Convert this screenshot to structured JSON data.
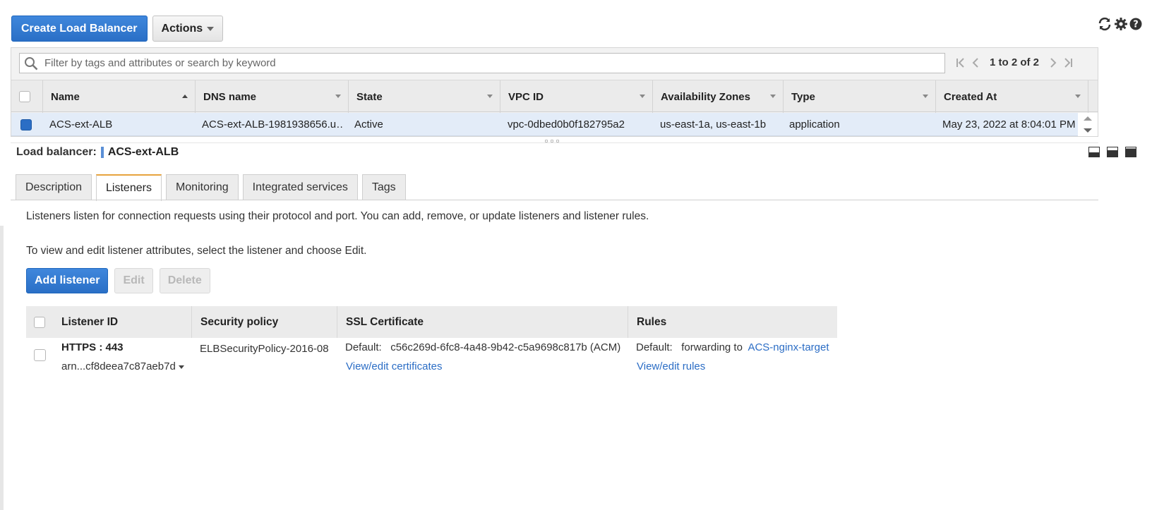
{
  "toolbar": {
    "create_label": "Create Load Balancer",
    "actions_label": "Actions"
  },
  "top_icons": [
    "refresh-icon",
    "gear-icon",
    "help-icon"
  ],
  "grid": {
    "search_placeholder": "Filter by tags and attributes or search by keyword",
    "pagination": "1 to 2 of 2",
    "columns": [
      {
        "label": "Name",
        "sort": "asc"
      },
      {
        "label": "DNS name",
        "sort": "none"
      },
      {
        "label": "State",
        "sort": "none"
      },
      {
        "label": "VPC ID",
        "sort": "none"
      },
      {
        "label": "Availability Zones",
        "sort": "none"
      },
      {
        "label": "Type",
        "sort": "none"
      },
      {
        "label": "Created At",
        "sort": "none"
      }
    ],
    "rows": [
      {
        "selected": true,
        "name": "ACS-ext-ALB",
        "dns": "ACS-ext-ALB-1981938656.u…",
        "state": "Active",
        "vpc": "vpc-0dbed0b0f182795a2",
        "azs": "us-east-1a, us-east-1b",
        "type": "application",
        "created": "May 23, 2022 at 8:04:01 PM …"
      }
    ]
  },
  "detail": {
    "label": "Load balancer:",
    "name": "ACS-ext-ALB",
    "tabs": [
      "Description",
      "Listeners",
      "Monitoring",
      "Integrated services",
      "Tags"
    ],
    "active_tab": "Listeners",
    "intro": "Listeners listen for connection requests using their protocol and port. You can add, remove, or update listeners and listener rules.",
    "edit_hint": "To view and edit listener attributes, select the listener and choose Edit.",
    "buttons": {
      "add": "Add listener",
      "edit": "Edit",
      "delete": "Delete"
    }
  },
  "listeners": {
    "columns": [
      "Listener ID",
      "Security policy",
      "SSL Certificate",
      "Rules"
    ],
    "rows": [
      {
        "protocol_port": "HTTPS : 443",
        "arn": "arn...cf8deea7c87aeb7d",
        "policy": "ELBSecurityPolicy-2016-08",
        "cert_prefix": "Default:",
        "cert_value": "c56c269d-6fc8-4a48-9b42-c5a9698c817b (ACM)",
        "cert_link": "View/edit certificates",
        "rules_prefix": "Default:",
        "rules_text": "forwarding to",
        "rules_target": "ACS-nginx-target",
        "rules_link": "View/edit rules"
      }
    ]
  },
  "colors": {
    "primary": "#2a6fc6",
    "selected_row": "#e3ecf8",
    "active_tab_accent": "#e7a33e",
    "link": "#2b6dc5"
  }
}
